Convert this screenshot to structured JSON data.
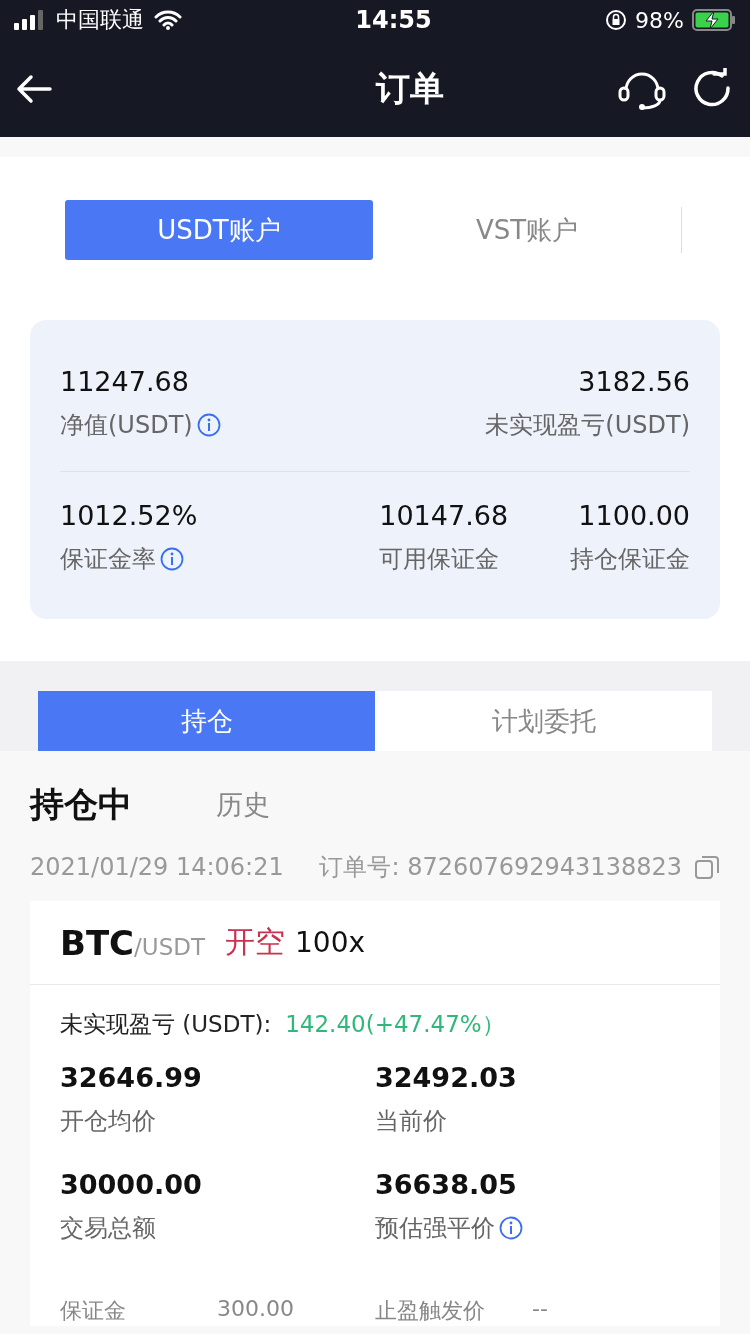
{
  "status_bar": {
    "carrier": "中国联通",
    "time": "14:55",
    "battery": "98%"
  },
  "nav": {
    "title": "订单"
  },
  "account_tabs": [
    {
      "label": "USDT账户",
      "selected": true
    },
    {
      "label": "VST账户",
      "selected": false
    }
  ],
  "summary": {
    "top": [
      {
        "value": "11247.68",
        "label": "净值(USDT)",
        "info": true
      },
      {
        "value": "3182.56",
        "label": "未实现盈亏(USDT)",
        "info": false
      }
    ],
    "bottom": [
      {
        "value": "1012.52%",
        "label": "保证金率",
        "info": true
      },
      {
        "value": "10147.68",
        "label": "可用保证金",
        "info": false
      },
      {
        "value": "1100.00",
        "label": "持仓保证金",
        "info": false
      }
    ]
  },
  "position_tabs": [
    {
      "label": "持仓",
      "selected": true
    },
    {
      "label": "计划委托",
      "selected": false
    }
  ],
  "sub_tabs": [
    {
      "label": "持仓中",
      "selected": true
    },
    {
      "label": "历史",
      "selected": false
    }
  ],
  "order": {
    "time": "2021/01/29 14:06:21",
    "number": "订单号: 872607692943138823"
  },
  "position": {
    "symbol": "BTC",
    "quote": "/USDT",
    "side": "开空",
    "leverage": "100x",
    "pnl_label": "未实现盈亏 (USDT):",
    "pnl_value": "142.40(+47.47%）",
    "stats": [
      {
        "value": "32646.99",
        "label": "开仓均价",
        "info": false
      },
      {
        "value": "32492.03",
        "label": "当前价",
        "info": false
      },
      {
        "value": "30000.00",
        "label": "交易总额",
        "info": false
      },
      {
        "value": "36638.05",
        "label": "预估强平价",
        "info": true
      }
    ],
    "details": [
      {
        "label": "保证金",
        "value": "300.00"
      },
      {
        "label": "止盈触发价",
        "value": "--"
      }
    ]
  }
}
